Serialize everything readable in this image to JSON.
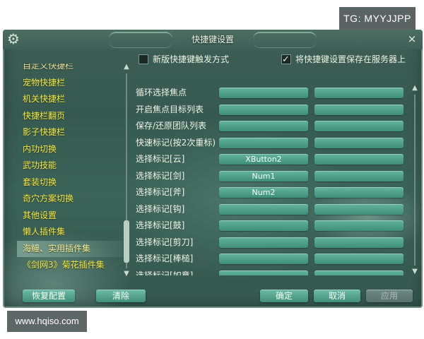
{
  "watermark_top": "TG: MYYJJPP",
  "watermark_bottom": "www.hqiso.com",
  "window": {
    "title": "快捷键设置",
    "close_glyph": "×",
    "gear_glyph": "⚙"
  },
  "options": {
    "new_trigger_label": "新版快捷键触发方式",
    "new_trigger_checked": false,
    "save_server_label": "将快捷键设置保存在服务器上",
    "save_server_checked": true
  },
  "categories": [
    {
      "label": "自定义快捷栏"
    },
    {
      "label": "宠物快捷栏"
    },
    {
      "label": "机关快捷栏"
    },
    {
      "label": "快捷栏翻页"
    },
    {
      "label": "影子快捷栏"
    },
    {
      "label": "内功切换"
    },
    {
      "label": "武功技能"
    },
    {
      "label": "套装切换"
    },
    {
      "label": "奇穴方案切换"
    },
    {
      "label": "其他设置"
    },
    {
      "label": "懒人插件集"
    },
    {
      "label": "海鳗、实用插件集"
    },
    {
      "label": "《剑网3》菊花插件集"
    }
  ],
  "selected_category": "海鳗、实用插件集",
  "rows": [
    {
      "label": "循环选择焦点",
      "key1": "",
      "key2": ""
    },
    {
      "label": "开启焦点目标列表",
      "key1": "",
      "key2": ""
    },
    {
      "label": "保存/还原团队列表",
      "key1": "",
      "key2": ""
    },
    {
      "label": "快速标记(按2次重标)",
      "key1": "",
      "key2": ""
    },
    {
      "label": "选择标记[云]",
      "key1": "XButton2",
      "key2": ""
    },
    {
      "label": "选择标记[剑]",
      "key1": "Num1",
      "key2": ""
    },
    {
      "label": "选择标记[斧]",
      "key1": "Num2",
      "key2": ""
    },
    {
      "label": "选择标记[钩]",
      "key1": "",
      "key2": ""
    },
    {
      "label": "选择标记[鼓]",
      "key1": "",
      "key2": ""
    },
    {
      "label": "选择标记[剪刀]",
      "key1": "",
      "key2": ""
    },
    {
      "label": "选择标记[棒槌]",
      "key1": "",
      "key2": ""
    },
    {
      "label": "选择标记[如意]",
      "key1": "",
      "key2": ""
    }
  ],
  "buttons": {
    "reset": "恢复配置",
    "clear": "清除",
    "confirm": "确定",
    "cancel": "取消",
    "apply": "应用"
  },
  "scroll": {
    "up_glyph": "▲",
    "down_glyph": "▼"
  }
}
